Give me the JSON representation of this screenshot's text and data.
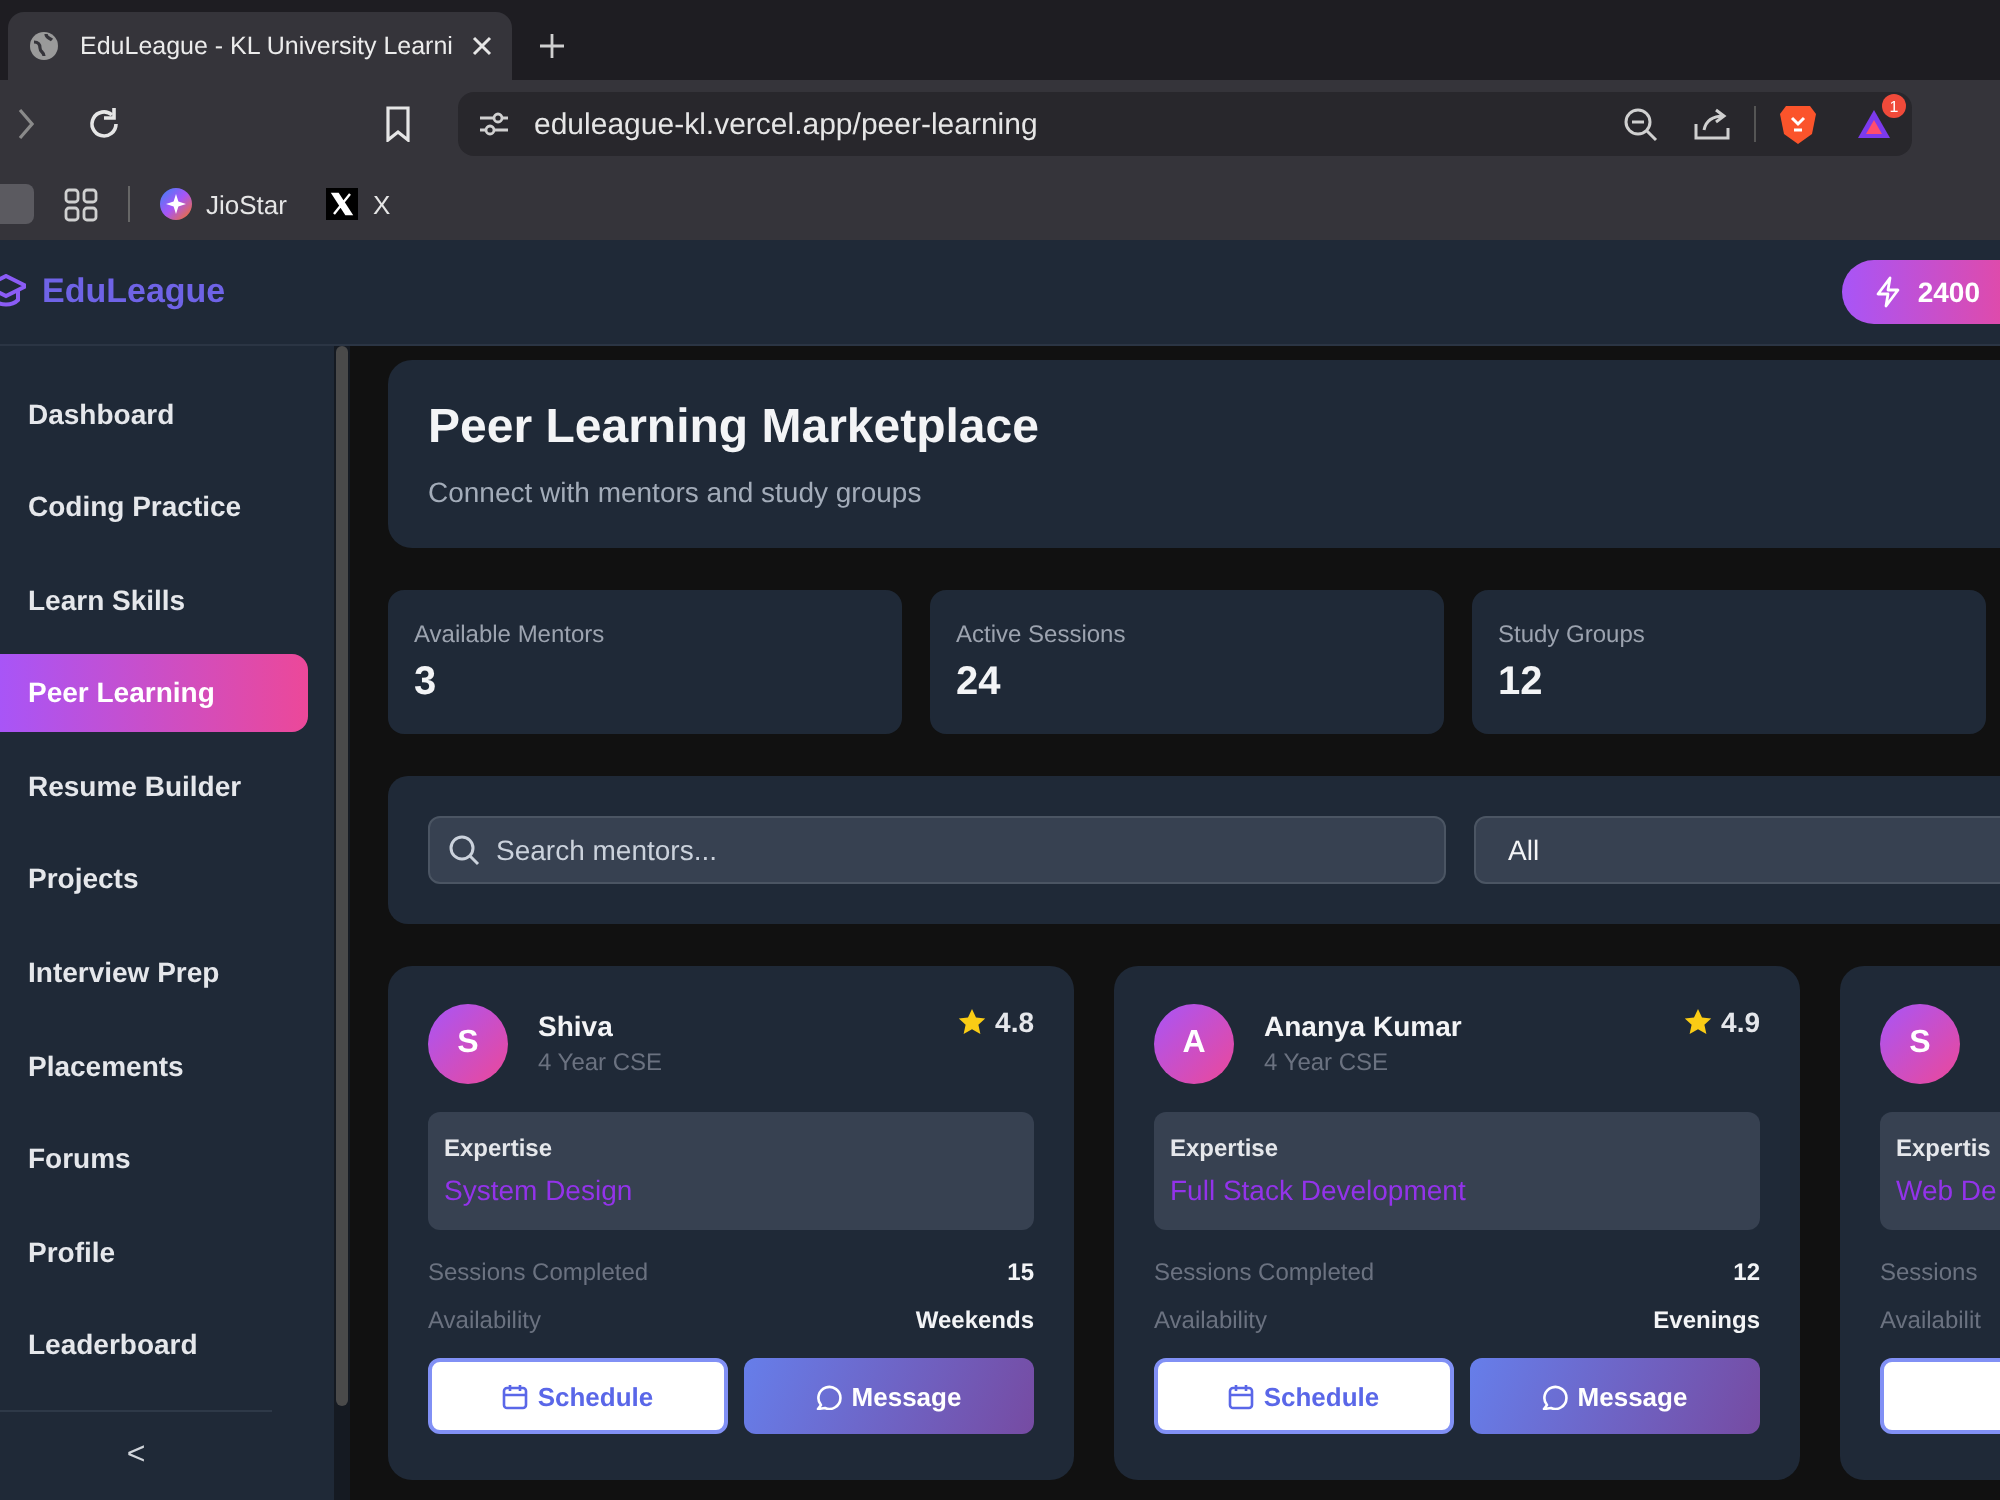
{
  "browser": {
    "tab_title": "EduLeague - KL University Learni",
    "url": "eduleague-kl.vercel.app/peer-learning",
    "extension_badge": "1",
    "bookmarks": [
      {
        "kind": "jiostar",
        "label": "JioStar"
      },
      {
        "kind": "x",
        "label": "X"
      }
    ]
  },
  "header": {
    "brand": "EduLeague",
    "points": "2400"
  },
  "sidebar": {
    "items": [
      {
        "label": "Dashboard",
        "selected": false
      },
      {
        "label": "Coding Practice",
        "selected": false
      },
      {
        "label": "Learn Skills",
        "selected": false
      },
      {
        "label": "Peer Learning",
        "selected": true
      },
      {
        "label": "Resume Builder",
        "selected": false
      },
      {
        "label": "Projects",
        "selected": false
      },
      {
        "label": "Interview Prep",
        "selected": false
      },
      {
        "label": "Placements",
        "selected": false
      },
      {
        "label": "Forums",
        "selected": false
      },
      {
        "label": "Profile",
        "selected": false
      },
      {
        "label": "Leaderboard",
        "selected": false
      }
    ],
    "collapse": "<"
  },
  "hero": {
    "title": "Peer Learning Marketplace",
    "subtitle": "Connect with mentors and study groups"
  },
  "stats": [
    {
      "label": "Available Mentors",
      "value": "3"
    },
    {
      "label": "Active Sessions",
      "value": "24"
    },
    {
      "label": "Study Groups",
      "value": "12"
    }
  ],
  "filters": {
    "search_placeholder": "Search mentors...",
    "category": "All"
  },
  "mentors": [
    {
      "initial": "S",
      "name": "Shiva",
      "year": "4 Year CSE",
      "rating": "4.8",
      "expertise_label": "Expertise",
      "expertise": "System Design",
      "rows": [
        {
          "label": "Sessions Completed",
          "value": "15"
        },
        {
          "label": "Availability",
          "value": "Weekends"
        }
      ],
      "buttons": [
        {
          "kind": "schedule",
          "label": "Schedule"
        },
        {
          "kind": "message",
          "label": "Message"
        }
      ]
    },
    {
      "initial": "A",
      "name": "Ananya Kumar",
      "year": "4 Year CSE",
      "rating": "4.9",
      "expertise_label": "Expertise",
      "expertise": "Full Stack Development",
      "rows": [
        {
          "label": "Sessions Completed",
          "value": "12"
        },
        {
          "label": "Availability",
          "value": "Evenings"
        }
      ],
      "buttons": [
        {
          "kind": "schedule",
          "label": "Schedule"
        },
        {
          "kind": "message",
          "label": "Message"
        }
      ]
    },
    {
      "initial": "S",
      "expertise_label": "Expertis",
      "expertise": "Web De",
      "rows": [
        {
          "label": "Sessions"
        },
        {
          "label": "Availabilit"
        }
      ],
      "buttons": [
        {
          "kind": "schedule"
        }
      ]
    }
  ]
}
